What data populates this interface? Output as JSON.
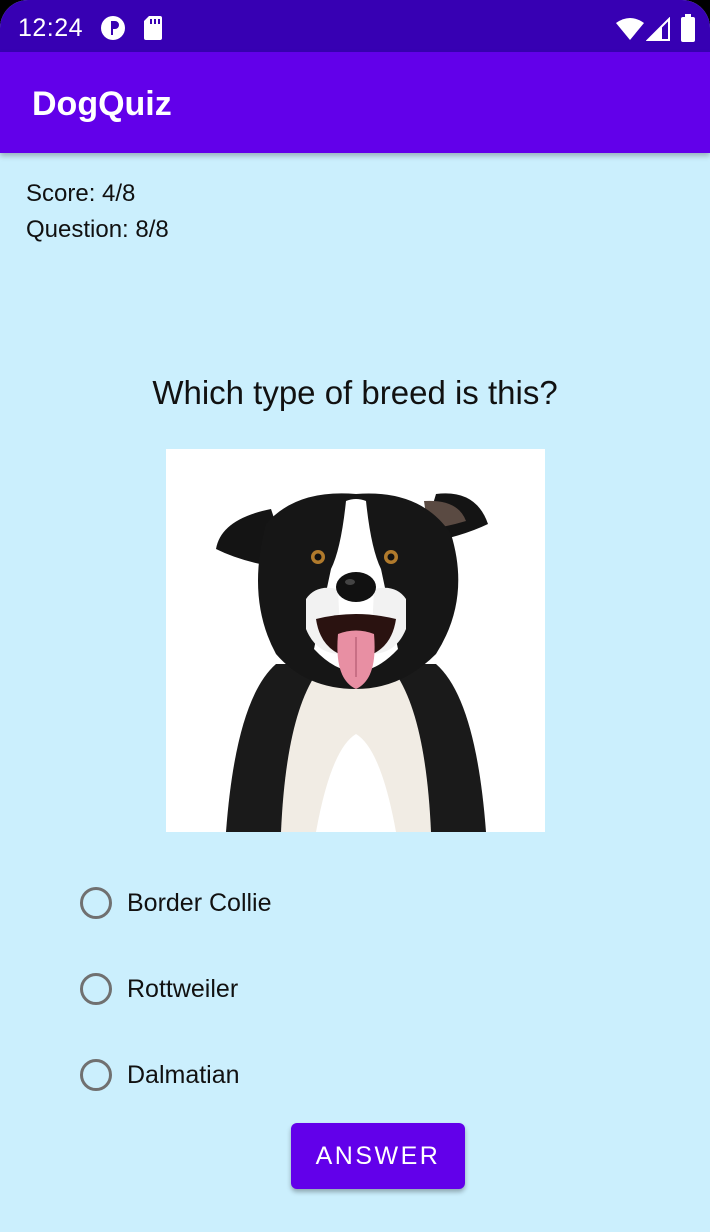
{
  "status_bar": {
    "time": "12:24",
    "icons": [
      "pie-status-icon",
      "sd-card-icon",
      "wifi-icon",
      "cell-signal-icon",
      "battery-icon"
    ]
  },
  "app_bar": {
    "title": "DogQuiz"
  },
  "quiz": {
    "score": "Score: 4/8",
    "question_counter": "Question: 8/8",
    "question_text": "Which type of breed is this?",
    "image": "border-collie-photo",
    "options": [
      {
        "label": "Border Collie",
        "selected": false
      },
      {
        "label": "Rottweiler",
        "selected": false
      },
      {
        "label": "Dalmatian",
        "selected": false
      }
    ],
    "answer_button": "ANSWER"
  },
  "colors": {
    "status_bar": "#3700b3",
    "app_bar": "#6200ea",
    "background": "#cbeffd",
    "accent": "#6200ea"
  }
}
